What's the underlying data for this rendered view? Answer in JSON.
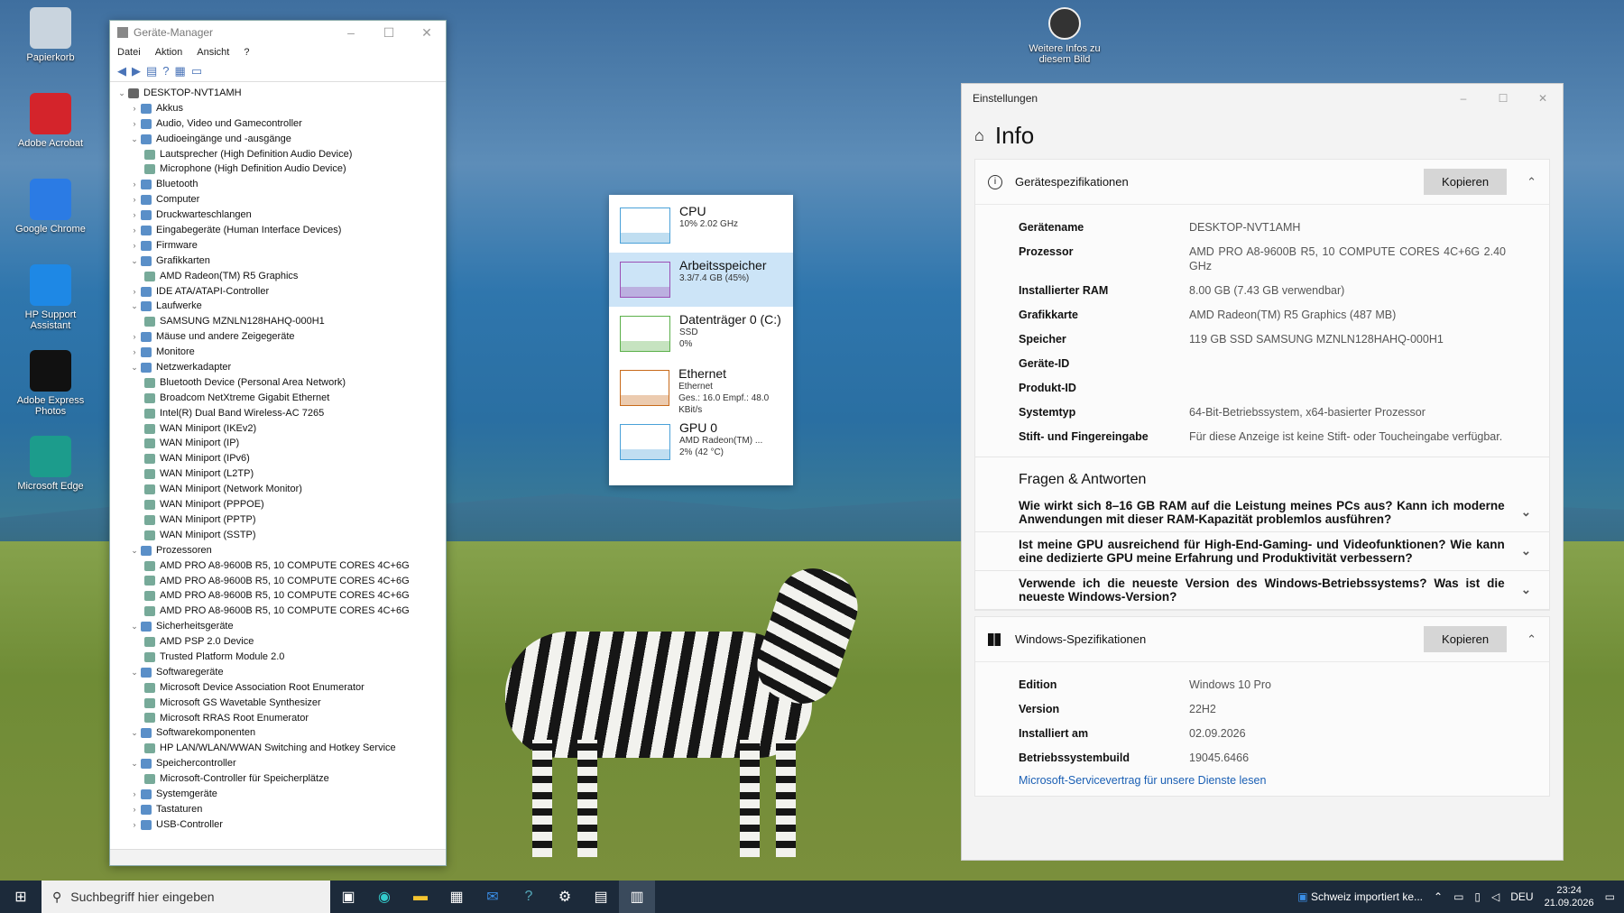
{
  "desktop": {
    "icons": [
      {
        "label": "Papierkorb",
        "color": "#c9d4de"
      },
      {
        "label": "Adobe Acrobat",
        "color": "#d4242b"
      },
      {
        "label": "Google Chrome",
        "color": "#2b7be4"
      },
      {
        "label": "HP Support Assistant",
        "color": "#1e88e5"
      },
      {
        "label": "Adobe Express Photos",
        "color": "#111"
      },
      {
        "label": "Microsoft Edge",
        "color": "#1c9c8c"
      }
    ],
    "top_icon": "Weitere Infos zu diesem Bild"
  },
  "devmgr": {
    "title": "Geräte-Manager",
    "menu": [
      "Datei",
      "Aktion",
      "Ansicht",
      "?"
    ],
    "tree": [
      {
        "l": "DESKTOP-NVT1AMH",
        "lvl": 0,
        "c": "v"
      },
      {
        "l": "Akkus",
        "lvl": 1,
        "c": ">"
      },
      {
        "l": "Audio, Video und Gamecontroller",
        "lvl": 1,
        "c": ">"
      },
      {
        "l": "Audioeingänge und -ausgänge",
        "lvl": 1,
        "c": "v"
      },
      {
        "l": "Lautsprecher (High Definition Audio Device)",
        "lvl": 2,
        "c": ""
      },
      {
        "l": "Microphone (High Definition Audio Device)",
        "lvl": 2,
        "c": ""
      },
      {
        "l": "Bluetooth",
        "lvl": 1,
        "c": ">"
      },
      {
        "l": "Computer",
        "lvl": 1,
        "c": ">"
      },
      {
        "l": "Druckwarteschlangen",
        "lvl": 1,
        "c": ">"
      },
      {
        "l": "Eingabegeräte (Human Interface Devices)",
        "lvl": 1,
        "c": ">"
      },
      {
        "l": "Firmware",
        "lvl": 1,
        "c": ">"
      },
      {
        "l": "Grafikkarten",
        "lvl": 1,
        "c": "v"
      },
      {
        "l": "AMD Radeon(TM) R5 Graphics",
        "lvl": 2,
        "c": ""
      },
      {
        "l": "IDE ATA/ATAPI-Controller",
        "lvl": 1,
        "c": ">"
      },
      {
        "l": "Laufwerke",
        "lvl": 1,
        "c": "v"
      },
      {
        "l": "SAMSUNG MZNLN128HAHQ-000H1",
        "lvl": 2,
        "c": ""
      },
      {
        "l": "Mäuse und andere Zeigegeräte",
        "lvl": 1,
        "c": ">"
      },
      {
        "l": "Monitore",
        "lvl": 1,
        "c": ">"
      },
      {
        "l": "Netzwerkadapter",
        "lvl": 1,
        "c": "v"
      },
      {
        "l": "Bluetooth Device (Personal Area Network)",
        "lvl": 2,
        "c": ""
      },
      {
        "l": "Broadcom NetXtreme Gigabit Ethernet",
        "lvl": 2,
        "c": ""
      },
      {
        "l": "Intel(R) Dual Band Wireless-AC 7265",
        "lvl": 2,
        "c": ""
      },
      {
        "l": "WAN Miniport (IKEv2)",
        "lvl": 2,
        "c": ""
      },
      {
        "l": "WAN Miniport (IP)",
        "lvl": 2,
        "c": ""
      },
      {
        "l": "WAN Miniport (IPv6)",
        "lvl": 2,
        "c": ""
      },
      {
        "l": "WAN Miniport (L2TP)",
        "lvl": 2,
        "c": ""
      },
      {
        "l": "WAN Miniport (Network Monitor)",
        "lvl": 2,
        "c": ""
      },
      {
        "l": "WAN Miniport (PPPOE)",
        "lvl": 2,
        "c": ""
      },
      {
        "l": "WAN Miniport (PPTP)",
        "lvl": 2,
        "c": ""
      },
      {
        "l": "WAN Miniport (SSTP)",
        "lvl": 2,
        "c": ""
      },
      {
        "l": "Prozessoren",
        "lvl": 1,
        "c": "v"
      },
      {
        "l": "AMD PRO A8-9600B R5, 10 COMPUTE CORES 4C+6G",
        "lvl": 2,
        "c": ""
      },
      {
        "l": "AMD PRO A8-9600B R5, 10 COMPUTE CORES 4C+6G",
        "lvl": 2,
        "c": ""
      },
      {
        "l": "AMD PRO A8-9600B R5, 10 COMPUTE CORES 4C+6G",
        "lvl": 2,
        "c": ""
      },
      {
        "l": "AMD PRO A8-9600B R5, 10 COMPUTE CORES 4C+6G",
        "lvl": 2,
        "c": ""
      },
      {
        "l": "Sicherheitsgeräte",
        "lvl": 1,
        "c": "v"
      },
      {
        "l": "AMD PSP 2.0 Device",
        "lvl": 2,
        "c": ""
      },
      {
        "l": "Trusted Platform Module 2.0",
        "lvl": 2,
        "c": ""
      },
      {
        "l": "Softwaregeräte",
        "lvl": 1,
        "c": "v"
      },
      {
        "l": "Microsoft Device Association Root Enumerator",
        "lvl": 2,
        "c": ""
      },
      {
        "l": "Microsoft GS Wavetable Synthesizer",
        "lvl": 2,
        "c": ""
      },
      {
        "l": "Microsoft RRAS Root Enumerator",
        "lvl": 2,
        "c": ""
      },
      {
        "l": "Softwarekomponenten",
        "lvl": 1,
        "c": "v"
      },
      {
        "l": "HP LAN/WLAN/WWAN Switching and Hotkey Service",
        "lvl": 2,
        "c": ""
      },
      {
        "l": "Speichercontroller",
        "lvl": 1,
        "c": "v"
      },
      {
        "l": "Microsoft-Controller für Speicherplätze",
        "lvl": 2,
        "c": ""
      },
      {
        "l": "Systemgeräte",
        "lvl": 1,
        "c": ">"
      },
      {
        "l": "Tastaturen",
        "lvl": 1,
        "c": ">"
      },
      {
        "l": "USB-Controller",
        "lvl": 1,
        "c": ">"
      }
    ]
  },
  "perf": {
    "items": [
      {
        "name": "CPU",
        "s1": "10% 2.02 GHz",
        "s2": "",
        "s3": "",
        "color": "#4aa1d8",
        "sel": false
      },
      {
        "name": "Arbeitsspeicher",
        "s1": "3.3/7.4 GB (45%)",
        "s2": "",
        "s3": "",
        "color": "#9b4fb5",
        "sel": true
      },
      {
        "name": "Datenträger 0 (C:)",
        "s1": "SSD",
        "s2": "0%",
        "s3": "",
        "color": "#5bb04a",
        "sel": false
      },
      {
        "name": "Ethernet",
        "s1": "Ethernet",
        "s2": "Ges.: 16.0 Empf.: 48.0 KBit/s",
        "s3": "",
        "color": "#c86a1a",
        "sel": false
      },
      {
        "name": "GPU 0",
        "s1": "AMD Radeon(TM) ...",
        "s2": "2% (42 °C)",
        "s3": "",
        "color": "#4aa1d8",
        "sel": false
      }
    ]
  },
  "settings": {
    "title": "Einstellungen",
    "page": "Info",
    "dev_spec": "Gerätespezifikationen",
    "copy": "Kopieren",
    "specs": [
      {
        "k": "Gerätename",
        "v": "DESKTOP-NVT1AMH"
      },
      {
        "k": "Prozessor",
        "v": "AMD PRO A8-9600B R5, 10 COMPUTE CORES 4C+6G 2.40 GHz"
      },
      {
        "k": "Installierter RAM",
        "v": "8.00 GB (7.43 GB verwendbar)"
      },
      {
        "k": "Grafikkarte",
        "v": "AMD Radeon(TM) R5 Graphics (487 MB)"
      },
      {
        "k": "Speicher",
        "v": "119 GB SSD SAMSUNG MZNLN128HAHQ-000H1"
      },
      {
        "k": "Geräte-ID",
        "v": ""
      },
      {
        "k": "Produkt-ID",
        "v": ""
      },
      {
        "k": "Systemtyp",
        "v": "64-Bit-Betriebssystem, x64-basierter Prozessor"
      },
      {
        "k": "Stift- und Fingereingabe",
        "v": "Für diese Anzeige ist keine Stift- oder Toucheingabe verfügbar."
      }
    ],
    "faq_title": "Fragen & Antworten",
    "faq": [
      "Wie wirkt sich 8–16 GB RAM auf die Leistung meines PCs aus? Kann ich moderne Anwendungen mit dieser RAM-Kapazität problemlos ausführen?",
      "Ist meine GPU ausreichend für High-End-Gaming- und Videofunktionen? Wie kann eine dedizierte GPU meine Erfahrung und Produktivität verbessern?",
      "Verwende ich die neueste Version des Windows-Betriebssystems? Was ist die neueste Windows-Version?"
    ],
    "win_spec": "Windows-Spezifikationen",
    "winspecs": [
      {
        "k": "Edition",
        "v": "Windows 10 Pro"
      },
      {
        "k": "Version",
        "v": "22H2"
      },
      {
        "k": "Installiert am",
        "v": "02.09.2026"
      },
      {
        "k": "Betriebssystembuild",
        "v": "19045.6466"
      }
    ],
    "link": "Microsoft-Servicevertrag für unsere Dienste lesen"
  },
  "taskbar": {
    "search": "Suchbegriff hier eingeben",
    "news": "Schweiz importiert ke...",
    "lang": "DEU",
    "time": "23:24",
    "date": "21.09.2026"
  }
}
